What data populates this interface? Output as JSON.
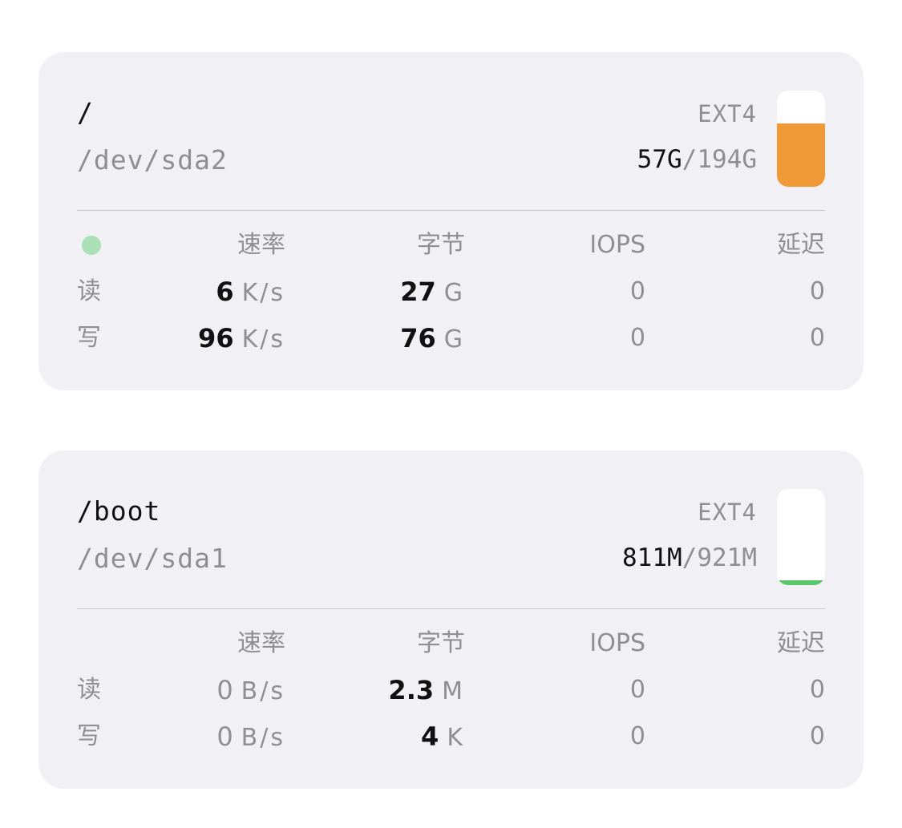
{
  "headers": {
    "rate": "速率",
    "bytes": "字节",
    "iops": "IOPS",
    "latency": "延迟"
  },
  "disks": [
    {
      "mount": "/",
      "device": "/dev/sda2",
      "fstype": "EXT4",
      "used": "57G",
      "total": "194G",
      "usage_fraction": 0.66,
      "gauge_color": "#f09a37",
      "activity_dot_color": "#abdfb6",
      "read": {
        "label": "读",
        "rate_value": "6",
        "rate_unit": "K/s",
        "bytes_value": "27",
        "bytes_unit": "G",
        "iops": "0",
        "latency": "0"
      },
      "write": {
        "label": "写",
        "rate_value": "96",
        "rate_unit": "K/s",
        "bytes_value": "76",
        "bytes_unit": "G",
        "iops": "0",
        "latency": "0"
      }
    },
    {
      "mount": "/boot",
      "device": "/dev/sda1",
      "fstype": "EXT4",
      "used": "811M",
      "total": "921M",
      "usage_fraction": 0.05,
      "gauge_color": "#5ac66a",
      "read": {
        "label": "读",
        "rate_value": "0",
        "rate_unit": "B/s",
        "bytes_value": "2.3",
        "bytes_unit": "M",
        "iops": "0",
        "latency": "0"
      },
      "write": {
        "label": "写",
        "rate_value": "0",
        "rate_unit": "B/s",
        "bytes_value": "4",
        "bytes_unit": "K",
        "iops": "0",
        "latency": "0"
      }
    }
  ]
}
